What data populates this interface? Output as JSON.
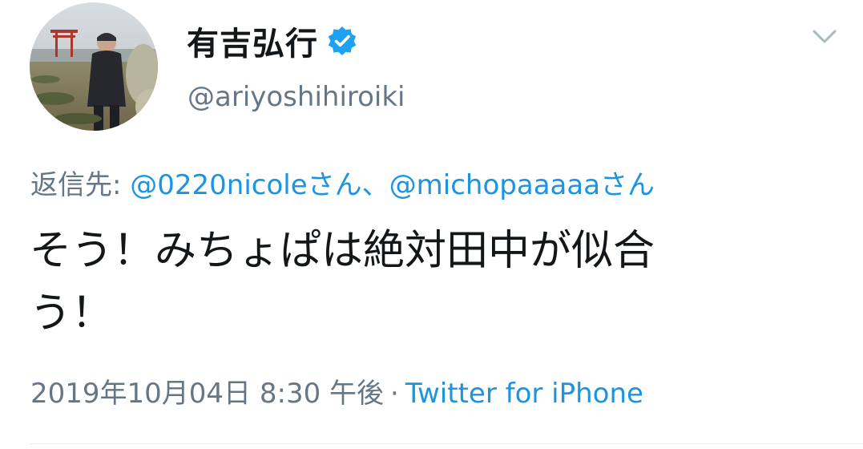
{
  "tweet": {
    "display_name": "有吉弘行",
    "verified": true,
    "handle": "@ariyoshihiroiki",
    "reply_to_label": "返信先:",
    "reply_mentions": [
      "@0220nicoleさん",
      "@michopaaaaaさん"
    ],
    "reply_separator": "、",
    "text_line1": "そう！みちょぱは絶対田中が似合",
    "text_line2": "う！",
    "timestamp": "2019年10月04日 8:30 午後",
    "separator": "·",
    "source": "Twitter for iPhone"
  },
  "colors": {
    "text_primary": "#14171a",
    "text_secondary": "#657786",
    "link": "#1b95e0",
    "verified_badge": "#1da1f2"
  },
  "icons": {
    "verified": "verified-badge-icon",
    "menu": "chevron-down-icon"
  }
}
